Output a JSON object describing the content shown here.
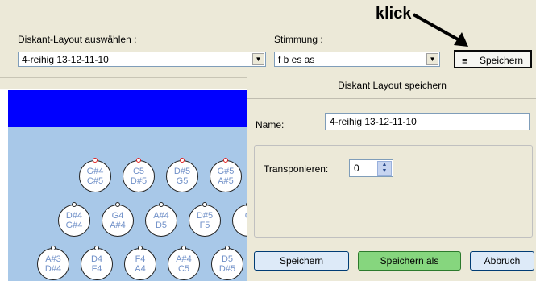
{
  "annotation": {
    "text": "klick"
  },
  "toolbar": {
    "layout_label": "Diskant-Layout auswählen :",
    "layout_value": "4-reihig 13-12-11-10",
    "tuning_label": "Stimmung :",
    "tuning_value": "f b es as",
    "save_label": "Speichern"
  },
  "keyboard": {
    "row1": [
      {
        "top": "G#4",
        "bottom": "C#5",
        "dot": "red"
      },
      {
        "top": "C5",
        "bottom": "D#5",
        "dot": "red"
      },
      {
        "top": "D#5",
        "bottom": "G5",
        "dot": "red"
      },
      {
        "top": "G#5",
        "bottom": "A#5",
        "dot": "red"
      }
    ],
    "row2": [
      {
        "top": "D#4",
        "bottom": "G#4",
        "dot": "black"
      },
      {
        "top": "G4",
        "bottom": "A#4",
        "dot": "black"
      },
      {
        "top": "A#4",
        "bottom": "D5",
        "dot": "black"
      },
      {
        "top": "D#5",
        "bottom": "F5",
        "dot": "black"
      },
      {
        "top": "G",
        "bottom": "",
        "dot": "black"
      }
    ],
    "row3": [
      {
        "top": "A#3",
        "bottom": "D#4",
        "dot": "black"
      },
      {
        "top": "D4",
        "bottom": "F4",
        "dot": "black"
      },
      {
        "top": "F4",
        "bottom": "A4",
        "dot": "black"
      },
      {
        "top": "A#4",
        "bottom": "C5",
        "dot": "black"
      },
      {
        "top": "D5",
        "bottom": "D#5",
        "dot": "black"
      }
    ]
  },
  "dialog": {
    "title": "Diskant Layout speichern",
    "name_label": "Name:",
    "name_value": "4-reihig 13-12-11-10",
    "transpose_label": "Transponieren:",
    "transpose_value": "0",
    "btn_save": "Speichern",
    "btn_save_as": "Speichern als",
    "btn_cancel": "Abbruch"
  }
}
